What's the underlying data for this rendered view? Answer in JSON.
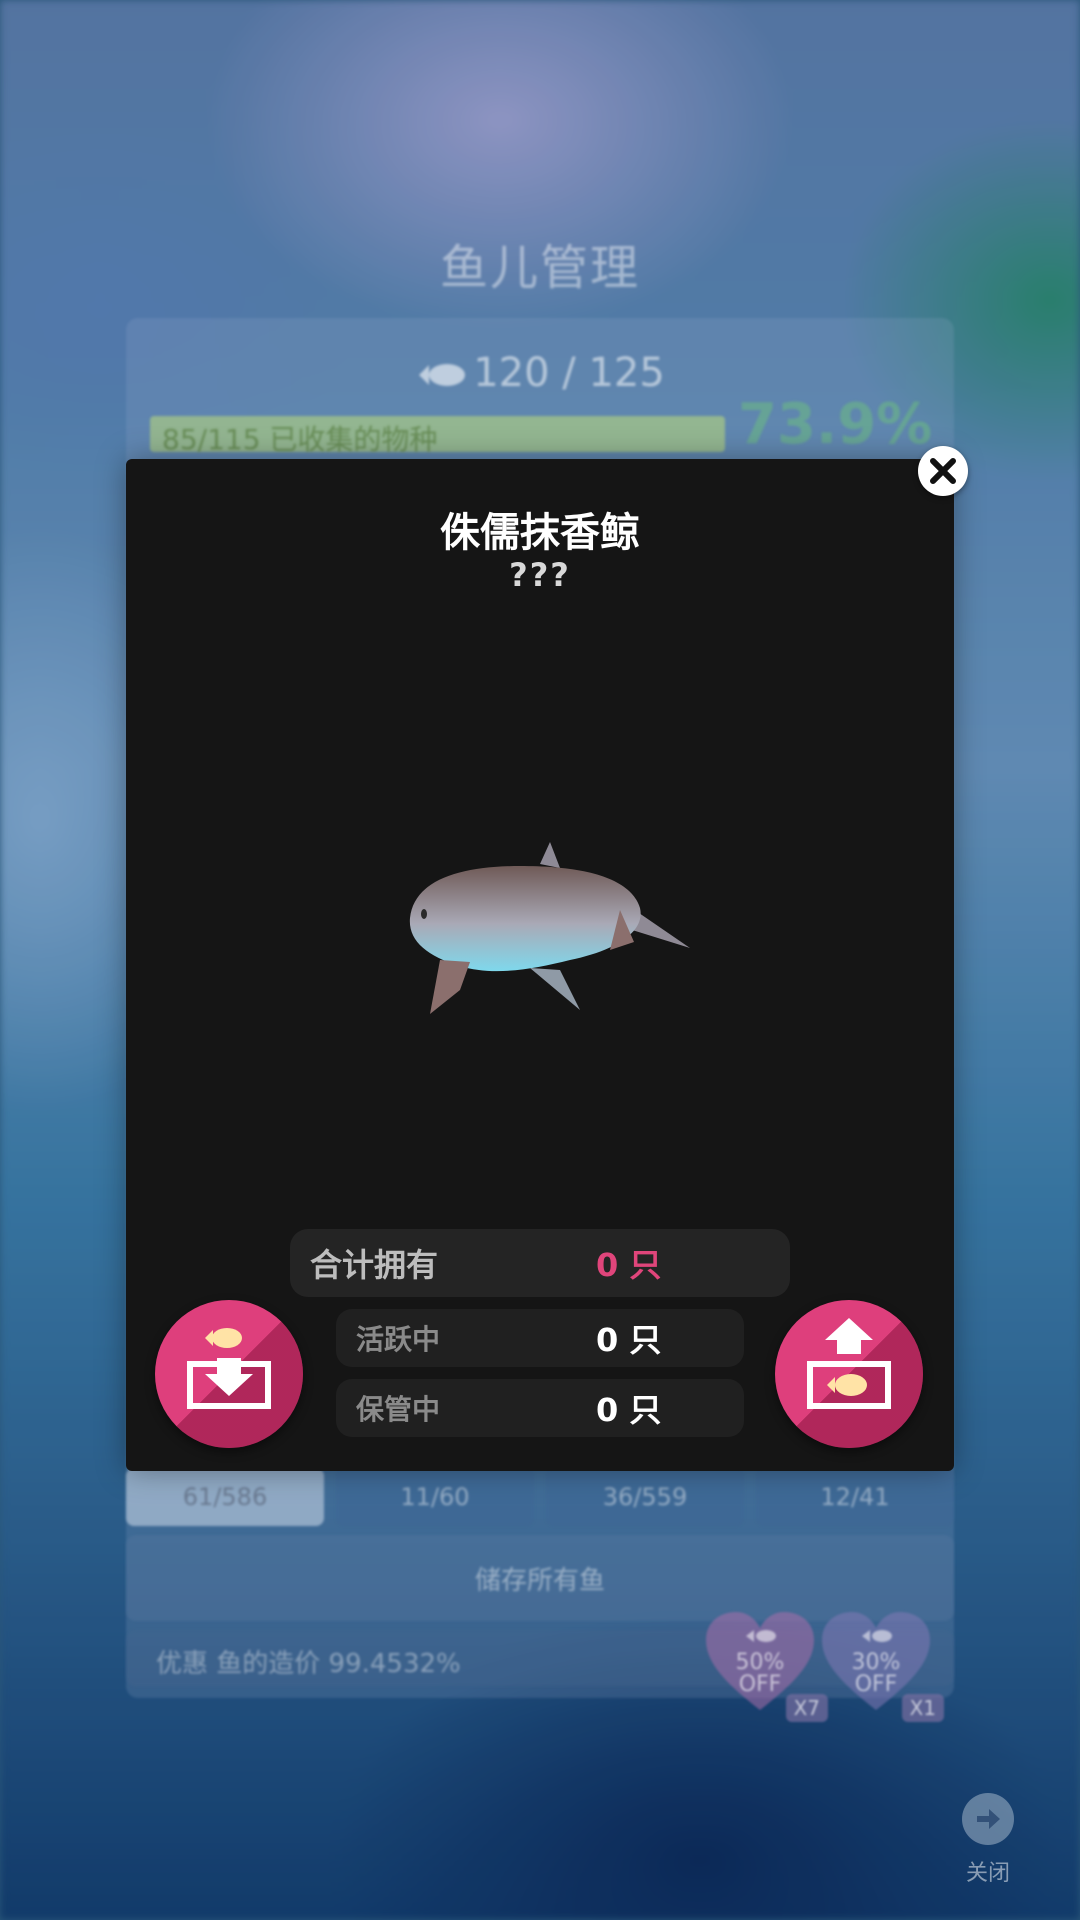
{
  "background": {
    "title": "鱼儿管理",
    "fish_count": "120 / 125",
    "collection_progress": "85/115 已收集的物种",
    "collection_percent": "73.9%",
    "collection_fraction": 0.739,
    "tabs": [
      "61/586",
      "11/60",
      "36/559",
      "12/41"
    ],
    "store_all_label": "储存所有鱼",
    "discount_text": "优惠 鱼的造价 99.4532%",
    "coupons": [
      {
        "label": "50%\nOFF",
        "count": "X7"
      },
      {
        "label": "30%\nOFF",
        "count": "X1"
      }
    ],
    "close_label": "关闭"
  },
  "modal": {
    "fish_name": "侏儒抹香鲸",
    "fish_subtitle": "???",
    "stats": {
      "total_label": "合计拥有",
      "total_value": "0 只",
      "active_label": "活跃中",
      "active_value": "0 只",
      "stored_label": "保管中",
      "stored_value": "0 只"
    }
  },
  "colors": {
    "accent": "#de3f7c",
    "total_value": "#e0457b",
    "modal_bg": "#151515"
  },
  "icons": {
    "close": "close-icon",
    "store_fish": "fish-into-tray-icon",
    "release_fish": "fish-out-of-tray-icon",
    "exit": "arrow-right-circle-icon"
  }
}
